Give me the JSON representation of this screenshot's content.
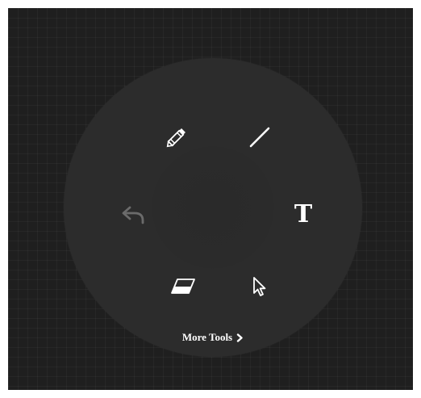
{
  "menu": {
    "more_tools_label": "More Tools",
    "text_tool_glyph": "T"
  },
  "tools": [
    {
      "id": "pencil",
      "icon": "pencil-icon"
    },
    {
      "id": "line",
      "icon": "line-icon"
    },
    {
      "id": "text",
      "icon": "text-icon"
    },
    {
      "id": "select",
      "icon": "cursor-icon"
    },
    {
      "id": "eraser",
      "icon": "eraser-icon"
    },
    {
      "id": "undo",
      "icon": "undo-arrow-icon",
      "state": "disabled"
    }
  ],
  "colors": {
    "canvas": "#1f1f1f",
    "wheel": "#2c2c2c",
    "icon": "#ffffff",
    "icon_disabled": "#8a8a8a"
  }
}
